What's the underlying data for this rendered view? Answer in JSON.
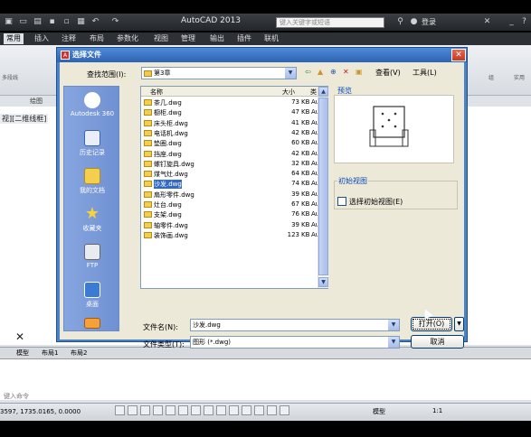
{
  "app": {
    "title": "AutoCAD 2013",
    "search_placeholder": "键入关键字或短语",
    "login": "登录"
  },
  "ribbon": {
    "tabs": [
      "常用",
      "插入",
      "注释",
      "布局",
      "参数化",
      "视图",
      "管理",
      "输出",
      "插件",
      "联机"
    ],
    "panel_draw": "绘图",
    "panel_groups": [
      "多段线",
      "组",
      "实用"
    ]
  },
  "viewport_label": "视][二维线框]",
  "layout_tabs": [
    "模型",
    "布局1",
    "布局2"
  ],
  "command": {
    "prompt": "键入命令"
  },
  "status": {
    "coords": "3597, 1735.0165, 0.0000",
    "model": "模型",
    "scale": "1:1"
  },
  "dialog": {
    "title": "选择文件",
    "lookin_label": "查找范围(I):",
    "lookin_value": "第3章",
    "view_menu": "查看(V)",
    "tools_menu": "工具(L)",
    "places": [
      "Autodesk 360",
      "历史记录",
      "我的文档",
      "收藏夹",
      "FTP",
      "桌面",
      ""
    ],
    "columns": {
      "name": "名称",
      "size": "大小",
      "type": "类"
    },
    "files": [
      {
        "name": "茶几.dwg",
        "size": "73",
        "kb": "KB",
        "type": "Au"
      },
      {
        "name": "橱柜.dwg",
        "size": "47",
        "kb": "KB",
        "type": "Au"
      },
      {
        "name": "床头柜.dwg",
        "size": "41",
        "kb": "KB",
        "type": "Au"
      },
      {
        "name": "电话机.dwg",
        "size": "42",
        "kb": "KB",
        "type": "Au"
      },
      {
        "name": "垫圈.dwg",
        "size": "60",
        "kb": "KB",
        "type": "Au"
      },
      {
        "name": "挡座.dwg",
        "size": "42",
        "kb": "KB",
        "type": "Au"
      },
      {
        "name": "螺钉旋具.dwg",
        "size": "32",
        "kb": "KB",
        "type": "Au"
      },
      {
        "name": "煤气灶.dwg",
        "size": "64",
        "kb": "KB",
        "type": "Au"
      },
      {
        "name": "沙发.dwg",
        "size": "74",
        "kb": "KB",
        "type": "Au"
      },
      {
        "name": "扇形零件.dwg",
        "size": "39",
        "kb": "KB",
        "type": "Au"
      },
      {
        "name": "灶台.dwg",
        "size": "67",
        "kb": "KB",
        "type": "Au"
      },
      {
        "name": "支架.dwg",
        "size": "76",
        "kb": "KB",
        "type": "Au"
      },
      {
        "name": "轴零件.dwg",
        "size": "39",
        "kb": "KB",
        "type": "Au"
      },
      {
        "name": "装饰画.dwg",
        "size": "123",
        "kb": "KB",
        "type": "Au"
      }
    ],
    "selected_index": 8,
    "preview_label": "预览",
    "initview_label": "初始视图",
    "initview_check": "选择初始视图(E)",
    "filename_label": "文件名(N):",
    "filename_value": "沙发.dwg",
    "filetype_label": "文件类型(T):",
    "filetype_value": "图形 (*.dwg)",
    "open_label": "打开(O)",
    "cancel_label": "取消"
  },
  "colors": {
    "accent": "#2d63b3",
    "selection": "#316ac5"
  }
}
